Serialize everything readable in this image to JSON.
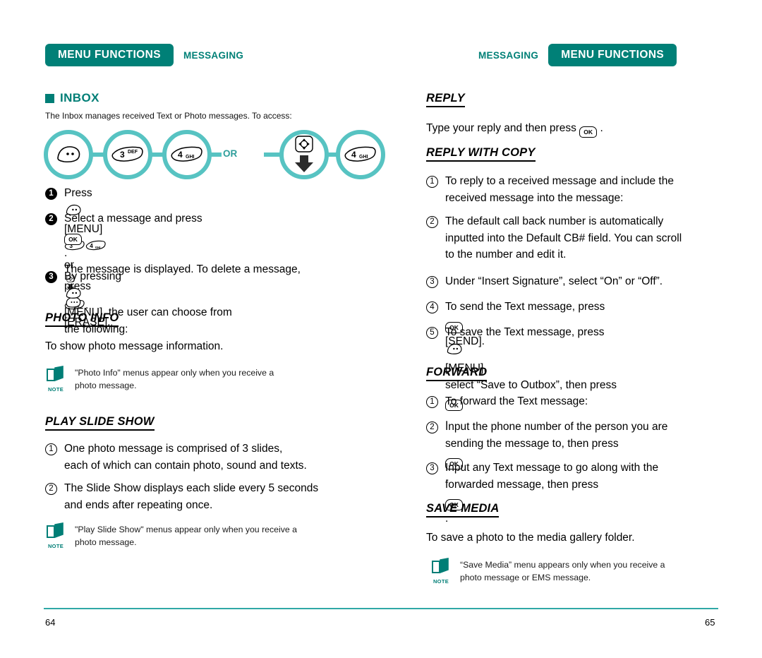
{
  "document": {
    "brand_color": "#008077",
    "accent_color": "#57c3c2",
    "rule_color": "#2fa8a6"
  },
  "left_page": {
    "header": {
      "badge": "MENU FUNCTIONS",
      "chapter": "MESSAGING"
    },
    "section": {
      "title": "INBOX",
      "intro": "The Inbox manages received Text or Photo messages. To access:"
    },
    "keyflow": {
      "or_label": "OR",
      "keys": [
        {
          "name": "menu-key",
          "label": ""
        },
        {
          "name": "key-3-def",
          "digit": "3",
          "letters": "DEF"
        },
        {
          "name": "key-4-ghi",
          "digit": "4",
          "letters": "GHI"
        },
        {
          "name": "navigation-down-key",
          "label": ""
        },
        {
          "name": "key-4-ghi",
          "digit": "4",
          "letters": "GHI"
        }
      ]
    },
    "steps": [
      {
        "num": "1",
        "style": "filled",
        "prefix": "Press",
        "parts": [
          "[MENU]",
          "or",
          "."
        ]
      },
      {
        "num": "2",
        "style": "filled",
        "line1_a": "Select a message and press",
        "line1_b": ".",
        "line2": "The message is displayed. To delete a message,",
        "line3_a": "press",
        "line3_b": "[ERASE]."
      },
      {
        "num": "3",
        "style": "filled",
        "line1_a": "By pressing",
        "line1_b": "[MENU], the user can choose from",
        "line2": "the following:"
      }
    ],
    "photo_info": {
      "heading": "PHOTO INFO",
      "body": "To show photo message information.",
      "note_label": "NOTE",
      "note_text": "\"Photo Info\" menus appear only when you receive a\nphoto message."
    },
    "play_slide_show": {
      "heading": "PLAY SLIDE SHOW",
      "steps": [
        {
          "num": "1",
          "text": "One photo message is comprised of 3 slides,\neach of which can contain photo, sound and texts."
        },
        {
          "num": "2",
          "text": "The Slide Show displays each slide every 5 seconds\nand ends after repeating once."
        }
      ],
      "note_label": "NOTE",
      "note_text": "\"Play Slide Show\" menus appear only when you receive a\nphoto message."
    },
    "page_number": "64"
  },
  "right_page": {
    "header": {
      "badge": "MENU FUNCTIONS",
      "chapter": "MESSAGING"
    },
    "reply": {
      "heading": "REPLY",
      "body_a": "Type your reply and then press",
      "body_b": "."
    },
    "reply_with_copy": {
      "heading": "REPLY WITH COPY",
      "steps": [
        {
          "num": "1",
          "text": "To reply to a received message and include the\nreceived message into the message:"
        },
        {
          "num": "2",
          "text": "The default call back number is automatically\ninputted into the Default CB# field. You can scroll\nto the number and edit it."
        },
        {
          "num": "3",
          "text": "Under “Insert Signature”, select “On” or “Off”."
        },
        {
          "num": "4",
          "text_a": "To send the Text message, press",
          "text_b": "[SEND]."
        },
        {
          "num": "5",
          "text_a": "To save the Text message, press",
          "text_b": "[MENU],",
          "text_c": "select “Save to Outbox”, then press",
          "text_d": "."
        }
      ]
    },
    "forward": {
      "heading": "FORWARD",
      "steps": [
        {
          "num": "1",
          "text": "To forward the Text message:"
        },
        {
          "num": "2",
          "text_a": "Input the phone number of the person you are\nsending the message to, then press",
          "text_b": "."
        },
        {
          "num": "3",
          "text_a": "Input any Text message to go along with the\nforwarded message, then press",
          "text_b": "."
        }
      ]
    },
    "save_media": {
      "heading": "SAVE MEDIA",
      "body": "To save a photo to the media gallery folder.",
      "note_label": "NOTE",
      "note_text": "“Save Media” menu appears only when you receive a\nphoto message or EMS message."
    },
    "page_number": "65"
  },
  "icons": {
    "ok_key": "OK",
    "menu_key": "menu-soft-key",
    "erase_key": "erase-soft-key",
    "nav_key": "navigation-key"
  }
}
